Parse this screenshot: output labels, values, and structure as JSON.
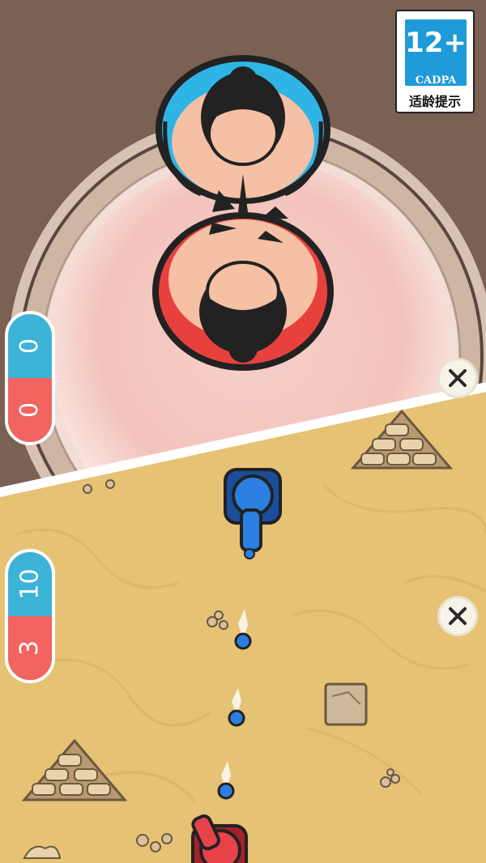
{
  "rating_badge": {
    "age": "12+",
    "org": "CADPA",
    "tip": "适龄提示",
    "color": "#1f9ad8"
  },
  "sumo_game": {
    "scoreboard": {
      "blue": "0",
      "red": "0"
    },
    "close_icon": "close-icon",
    "colors": {
      "blue": "#3db4d7",
      "red": "#f2645f",
      "ring": "#f5c9c2",
      "ground": "#7b6054"
    }
  },
  "tank_game": {
    "scoreboard": {
      "blue": "10",
      "red": "3"
    },
    "close_icon": "close-icon",
    "colors": {
      "sand": "#e6c275",
      "tank_blue": "#2b7fe0",
      "tank_red": "#e8424a"
    }
  }
}
